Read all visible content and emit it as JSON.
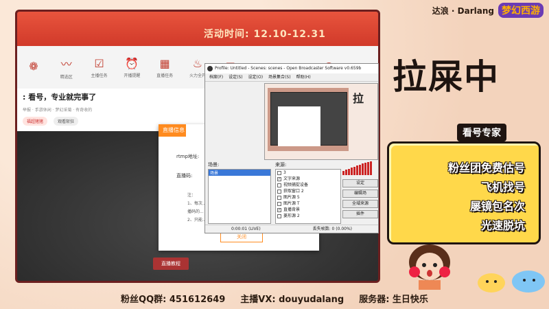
{
  "branding": {
    "streamer": "达浪 · Darlang",
    "logo": "梦幻西游"
  },
  "browser": {
    "banner_text": "活动时间: 12.10-12.31",
    "toolbar_items": [
      "",
      "精选区",
      "主播任务",
      "开播提醒",
      "直播任务",
      "火力全开",
      "",
      "",
      "",
      "",
      ""
    ],
    "stream_title": ": 看号，专业就完事了",
    "stream_meta": "举报 · 手游休闲 · 梦幻采菊 · 有奇收的",
    "pill1": "福超猪猪",
    "pill2": "观看斩狂",
    "live_button": "直播教程"
  },
  "dialog": {
    "header": "直播信息",
    "rtmp_label": "rtmp地址:",
    "code_label": "直播码:",
    "note_1": "注：",
    "note_2": "1、每次...",
    "note_3": "播码的...",
    "note_4": "2、只能...",
    "close_button": "关闭"
  },
  "obs": {
    "title": "Profile: Untitled - Scenes: scenes - Open Broadcaster Software v0.659b",
    "menu": [
      "档案(F)",
      "设定(S)",
      "设定(O)",
      "场景集合(S)",
      "帮助(H)"
    ],
    "scene_label": "场景:",
    "source_label": "来源:",
    "scenes": [
      "场景"
    ],
    "sources": [
      {
        "name": "3",
        "checked": false
      },
      {
        "name": "文字来源",
        "checked": true
      },
      {
        "name": "视频捕捉设备",
        "checked": false
      },
      {
        "name": "获取窗口 2",
        "checked": false
      },
      {
        "name": "图片源 5",
        "checked": false
      },
      {
        "name": "图片源 T",
        "checked": false
      },
      {
        "name": "直播背景",
        "checked": true
      },
      {
        "name": "菱形源 2",
        "checked": false
      }
    ],
    "buttons": [
      "设定",
      "编辑场",
      "全域来源",
      "插件"
    ],
    "status_time": "0:00:01 (LIVE)",
    "status_frames": "丢失帧数: 0 (0.00%)",
    "preview_text": "拉"
  },
  "right_panel": {
    "big_title": "拉屎中",
    "expert_tag": "看号专家",
    "bubble_lines": [
      "粉丝团免费估号",
      "飞机找号",
      "屡镜包名次",
      "光速脱坑"
    ]
  },
  "footer": {
    "qq": "粉丝QQ群: 451612649",
    "vx": "主播VX: douyudalang",
    "server": "服务器: 生日快乐"
  }
}
